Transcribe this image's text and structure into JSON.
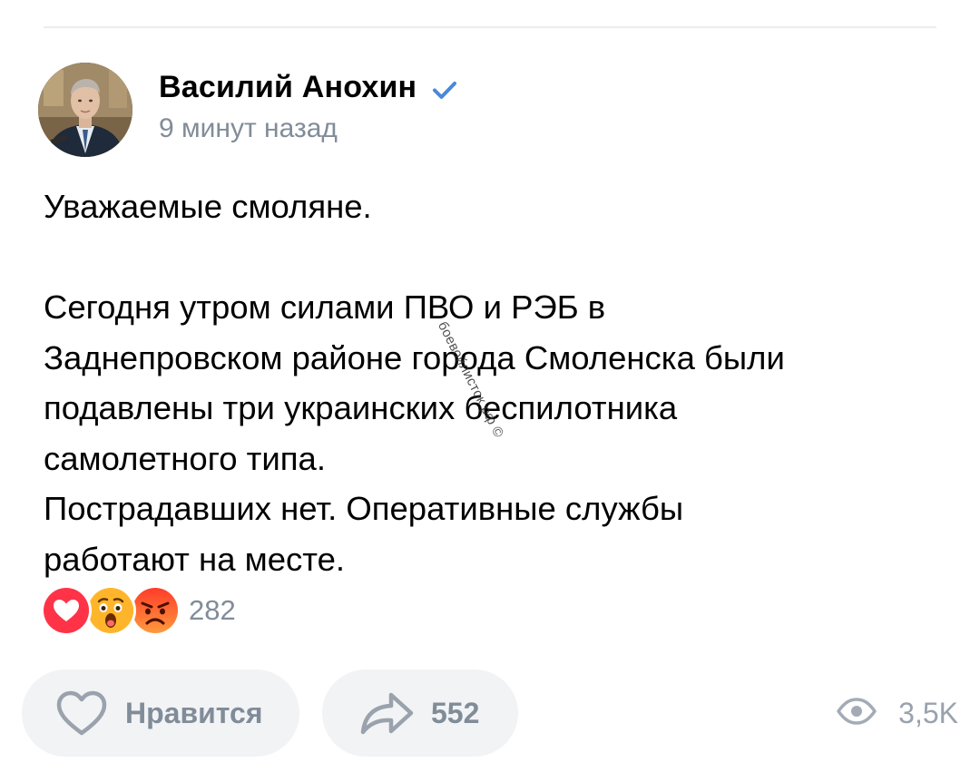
{
  "post": {
    "author": "Василий Анохин",
    "time": "9 минут назад",
    "verified": true,
    "paragraphs": [
      [
        "Уважаемые смоляне."
      ],
      [
        "Сегодня утром силами ПВО и РЭБ в",
        "Заднепровском районе города Смоленска были",
        "подавлены три украинских  беспилотника",
        "самолетного типа.",
        "Пострадавших нет. Оперативные службы",
        "работают на месте."
      ]
    ],
    "watermark": "боевойлисток.рф ©"
  },
  "reactions": {
    "items": [
      {
        "name": "heart",
        "color": "#ff3347"
      },
      {
        "name": "wow",
        "color": "#ffb52b"
      },
      {
        "name": "angry",
        "color": "#ff5a3c"
      }
    ],
    "count": "282"
  },
  "actions": {
    "like_label": "Нравится",
    "share_count": "552",
    "views_count": "3,5K"
  },
  "colors": {
    "verified": "#4a88d9",
    "secondary_text": "#818c99",
    "button_background": "#f2f3f5"
  }
}
